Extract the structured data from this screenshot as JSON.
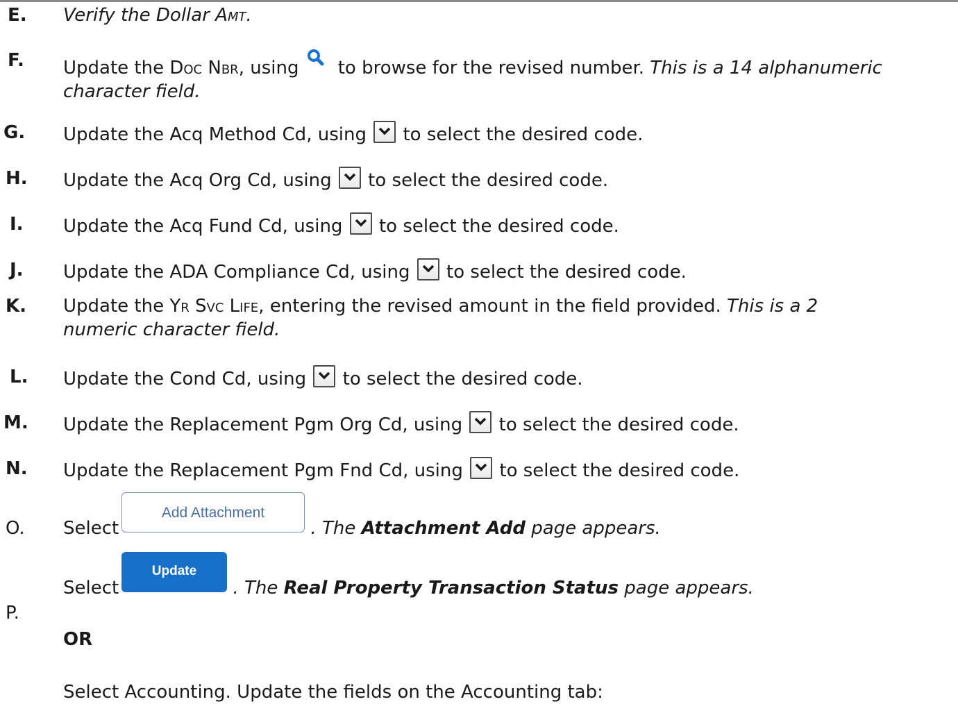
{
  "steps": {
    "e": {
      "letter": "E.",
      "text": "Verify the Dollar ",
      "field": "Amt",
      "end": "."
    },
    "f": {
      "letter": "F.",
      "pre": "Update the ",
      "field": "Doc Nbr",
      "mid": ", using",
      "post": " to browse for the revised number. ",
      "note1": "This is a 14 alphanumeric",
      "note2": "character field."
    },
    "g": {
      "letter": "G.",
      "pre": "Update the Acq Method Cd, using",
      "post": " to select the desired code."
    },
    "h": {
      "letter": "H.",
      "pre": "Update the Acq Org Cd, using",
      "post": " to select the desired code."
    },
    "i": {
      "letter": "I.",
      "pre": "Update the Acq Fund Cd, using",
      "post": " to select the desired code."
    },
    "j": {
      "letter": "J.",
      "pre": "Update the ADA Compliance Cd, using",
      "post": " to select the desired code."
    },
    "k": {
      "letter": "K.",
      "pre": "Update the ",
      "field": "Yr Svc Life",
      "post": ", entering the revised amount in the field provided. ",
      "note1": "This is a 2",
      "note2": "numeric character field."
    },
    "l": {
      "letter": "L.",
      "pre": "Update the Cond Cd, using",
      "post": " to select the desired code."
    },
    "m": {
      "letter": "M.",
      "pre": "Update the Replacement Pgm Org Cd, using",
      "post": " to select the desired code."
    },
    "n": {
      "letter": "N.",
      "pre": "Update the Replacement Pgm Fnd Cd, using",
      "post": " to select the desired code."
    },
    "o": {
      "letter": "O.",
      "pre": "Select",
      "button": "Add Attachment",
      "post1": ". The ",
      "bold": "Attachment Add",
      "post2": " page appears."
    },
    "p": {
      "letter": "P.",
      "pre": "Select",
      "button": "Update",
      "post1": ". The ",
      "bold": "Real Property Transaction Status",
      "post2": " page appears.",
      "or": "OR",
      "alt": "Select Accounting. Update the fields on the Accounting tab:"
    }
  },
  "icons": {
    "browse": "magnifier-icon",
    "dropdown": "chevron-down-icon"
  },
  "colors": {
    "button_primary": "#1670c8",
    "button_secondary_text": "#4a6d9e",
    "browse_icon": "#1b73d1"
  }
}
